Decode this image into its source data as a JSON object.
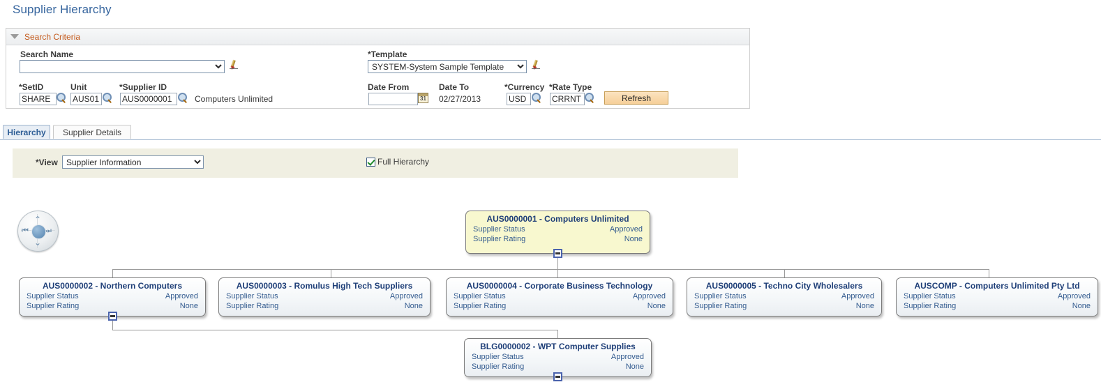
{
  "page": {
    "title": "Supplier Hierarchy"
  },
  "search": {
    "header_label": "Search Criteria",
    "collapse_icon": "triangle-down-icon",
    "search_name": {
      "label": "Search Name",
      "value": "",
      "edit_icon": "pencil-icon"
    },
    "template": {
      "label": "*Template",
      "value": "SYSTEM-System Sample Template",
      "options": [
        "SYSTEM-System Sample Template"
      ],
      "edit_icon": "pencil-icon"
    },
    "setid": {
      "label": "*SetID",
      "value": "SHARE",
      "lookup_icon": "magnifier-icon"
    },
    "unit": {
      "label": "Unit",
      "value": "AUS01",
      "lookup_icon": "magnifier-icon"
    },
    "supplier_id": {
      "label": "*Supplier ID",
      "value": "AUS0000001",
      "lookup_icon": "magnifier-icon"
    },
    "supplier_name_text": "Computers Unlimited",
    "date_from": {
      "label": "Date From",
      "value": "",
      "calendar_icon": "calendar-icon",
      "calendar_glyph": "31"
    },
    "date_to": {
      "label": "Date To",
      "value": "02/27/2013"
    },
    "currency": {
      "label": "*Currency",
      "value": "USD",
      "lookup_icon": "magnifier-icon"
    },
    "rate_type": {
      "label": "*Rate Type",
      "value": "CRRNT",
      "lookup_icon": "magnifier-icon"
    },
    "refresh_label": "Refresh"
  },
  "tabs": [
    {
      "label": "Hierarchy",
      "active": true
    },
    {
      "label": "Supplier Details",
      "active": false
    }
  ],
  "view_bar": {
    "view_label": "*View",
    "view_value": "Supplier Information",
    "view_options": [
      "Supplier Information"
    ],
    "full_hierarchy_label": "Full Hierarchy",
    "full_hierarchy_checked": true
  },
  "navigation": {
    "name": "pan-navigation-control",
    "up": "⌃",
    "down": "⌄",
    "left": "⏮",
    "right": "⏭",
    "center": "recenter-button"
  },
  "hierarchy": {
    "row_labels": {
      "status": "Supplier Status",
      "rating": "Supplier Rating"
    },
    "root": {
      "id": "AUS0000001",
      "title": "AUS0000001 - Computers Unlimited",
      "status_label": "Supplier Status",
      "status_value": "Approved",
      "rating_label": "Supplier Rating",
      "rating_value": "None",
      "collapse_icon": "minus-icon"
    },
    "children": [
      {
        "id": "AUS0000002",
        "title": "AUS0000002 - Northern Computers",
        "status_label": "Supplier Status",
        "status_value": "Approved",
        "rating_label": "Supplier Rating",
        "rating_value": "None",
        "collapse_icon": "minus-icon"
      },
      {
        "id": "AUS0000003",
        "title": "AUS0000003 - Romulus High Tech Suppliers",
        "status_label": "Supplier Status",
        "status_value": "Approved",
        "rating_label": "Supplier Rating",
        "rating_value": "None",
        "collapse_icon": null
      },
      {
        "id": "AUS0000004",
        "title": "AUS0000004 - Corporate Business Technology",
        "status_label": "Supplier Status",
        "status_value": "Approved",
        "rating_label": "Supplier Rating",
        "rating_value": "None",
        "collapse_icon": null
      },
      {
        "id": "AUS0000005",
        "title": "AUS0000005 - Techno City Wholesalers",
        "status_label": "Supplier Status",
        "status_value": "Approved",
        "rating_label": "Supplier Rating",
        "rating_value": "None",
        "collapse_icon": null
      },
      {
        "id": "AUSCOMP",
        "title": "AUSCOMP - Computers Unlimited Pty Ltd",
        "status_label": "Supplier Status",
        "status_value": "Approved",
        "rating_label": "Supplier Rating",
        "rating_value": "None",
        "collapse_icon": null
      }
    ],
    "grandchild": {
      "id": "BLG0000002",
      "title": "BLG0000002 - WPT Computer Supplies",
      "status_label": "Supplier Status",
      "status_value": "Approved",
      "rating_label": "Supplier Rating",
      "rating_value": "None",
      "collapse_icon": "minus-icon"
    }
  },
  "colors": {
    "title_blue": "#36659e",
    "section_orange": "#c4591b",
    "root_node_bg": "#f8f8cf",
    "view_bar_bg": "#f0efe2",
    "node_title_blue": "#1f3f78",
    "node_text_blue": "#335b8f",
    "refresh_bg": "#f6cf99"
  }
}
